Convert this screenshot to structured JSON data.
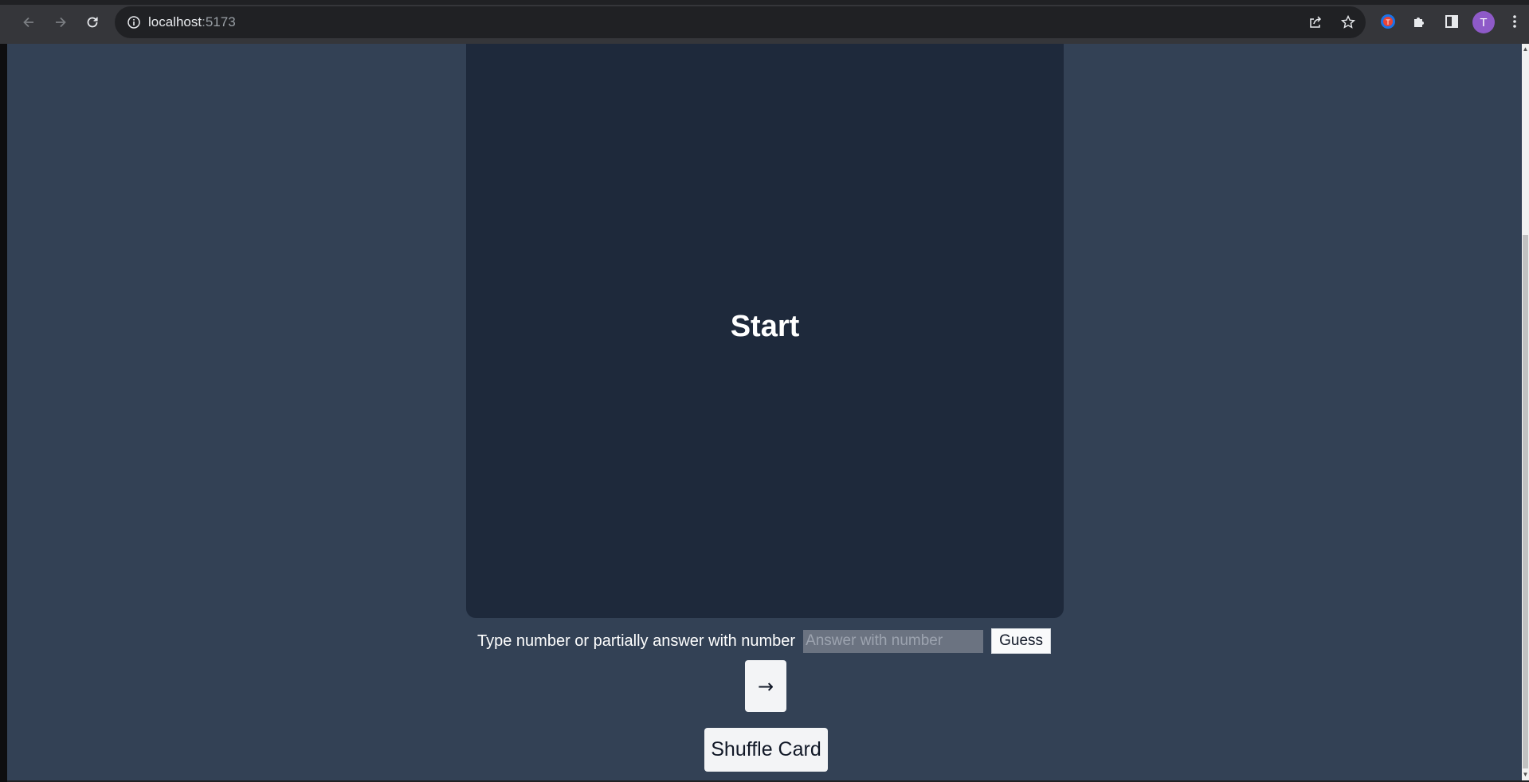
{
  "browser": {
    "url_host": "localhost",
    "url_port": ":5173",
    "profile_initial": "T",
    "icons": {
      "back": "arrow-left-icon",
      "forward": "arrow-right-icon",
      "reload": "reload-icon",
      "site_info": "info-icon",
      "share": "share-icon",
      "bookmark": "star-icon",
      "extension": "extension-icon",
      "extensions_menu": "puzzle-icon",
      "side_panel": "side-panel-icon",
      "menu": "kebab-menu-icon"
    }
  },
  "card": {
    "title": "Start"
  },
  "guess": {
    "label": "Type number or partially answer with number",
    "input_value": "",
    "placeholder": "Answer with number",
    "button_label": "Guess"
  },
  "controls": {
    "next_label": "→",
    "shuffle_label": "Shuffle Card"
  },
  "colors": {
    "page_background": "#334155",
    "card_background": "#1e293b",
    "chrome_background": "#35363a",
    "avatar": "#8e5ac8"
  }
}
